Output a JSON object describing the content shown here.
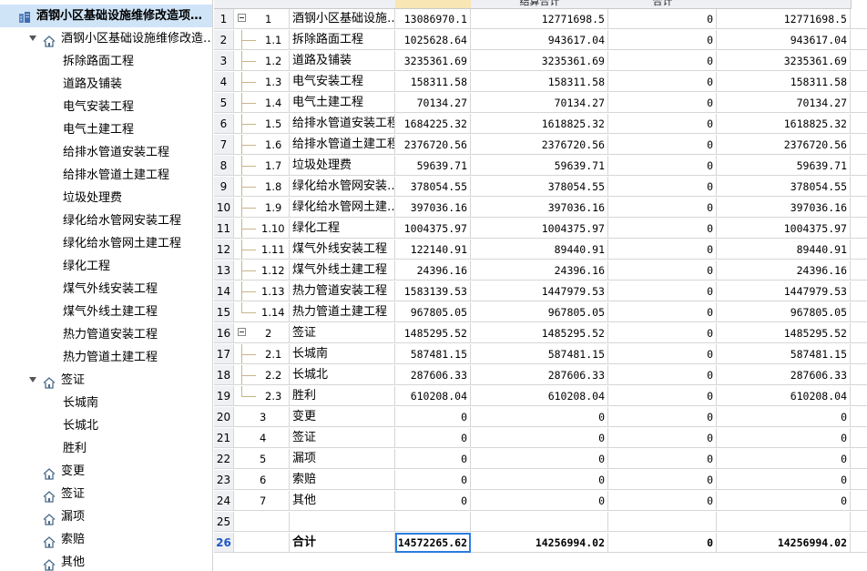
{
  "tree": {
    "root_label": "酒钢小区基础设施维修改造项…",
    "project_label": "酒钢小区基础设施维修改造…",
    "project_children": [
      "拆除路面工程",
      "道路及铺装",
      "电气安装工程",
      "电气土建工程",
      "给排水管道安装工程",
      "给排水管道土建工程",
      "垃圾处理费",
      "绿化给水管网安装工程",
      "绿化给水管网土建工程",
      "绿化工程",
      "煤气外线安装工程",
      "煤气外线土建工程",
      "热力管道安装工程",
      "热力管道土建工程"
    ],
    "visa_label": "签证",
    "visa_children": [
      "长城南",
      "长城北",
      "胜利"
    ],
    "others": [
      "变更",
      "签证",
      "漏项",
      "索赔",
      "其他"
    ]
  },
  "grid": {
    "headers": [
      "",
      "结算合计",
      "合计",
      ""
    ],
    "rows": [
      {
        "rn": "1",
        "code": "1",
        "name": "酒钢小区基础设施…",
        "a": "13086970.1",
        "b": "12771698.5",
        "c": "0",
        "d": "12771698.5"
      },
      {
        "rn": "2",
        "code": "1.1",
        "name": "拆除路面工程",
        "a": "1025628.64",
        "b": "943617.04",
        "c": "0",
        "d": "943617.04"
      },
      {
        "rn": "3",
        "code": "1.2",
        "name": "道路及铺装",
        "a": "3235361.69",
        "b": "3235361.69",
        "c": "0",
        "d": "3235361.69"
      },
      {
        "rn": "4",
        "code": "1.3",
        "name": "电气安装工程",
        "a": "158311.58",
        "b": "158311.58",
        "c": "0",
        "d": "158311.58"
      },
      {
        "rn": "5",
        "code": "1.4",
        "name": "电气土建工程",
        "a": "70134.27",
        "b": "70134.27",
        "c": "0",
        "d": "70134.27"
      },
      {
        "rn": "6",
        "code": "1.5",
        "name": "给排水管道安装工程",
        "a": "1684225.32",
        "b": "1618825.32",
        "c": "0",
        "d": "1618825.32"
      },
      {
        "rn": "7",
        "code": "1.6",
        "name": "给排水管道土建工程",
        "a": "2376720.56",
        "b": "2376720.56",
        "c": "0",
        "d": "2376720.56"
      },
      {
        "rn": "8",
        "code": "1.7",
        "name": "垃圾处理费",
        "a": "59639.71",
        "b": "59639.71",
        "c": "0",
        "d": "59639.71"
      },
      {
        "rn": "9",
        "code": "1.8",
        "name": "绿化给水管网安装…",
        "a": "378054.55",
        "b": "378054.55",
        "c": "0",
        "d": "378054.55"
      },
      {
        "rn": "10",
        "code": "1.9",
        "name": "绿化给水管网土建…",
        "a": "397036.16",
        "b": "397036.16",
        "c": "0",
        "d": "397036.16"
      },
      {
        "rn": "11",
        "code": "1.10",
        "name": "绿化工程",
        "a": "1004375.97",
        "b": "1004375.97",
        "c": "0",
        "d": "1004375.97"
      },
      {
        "rn": "12",
        "code": "1.11",
        "name": "煤气外线安装工程",
        "a": "122140.91",
        "b": "89440.91",
        "c": "0",
        "d": "89440.91"
      },
      {
        "rn": "13",
        "code": "1.12",
        "name": "煤气外线土建工程",
        "a": "24396.16",
        "b": "24396.16",
        "c": "0",
        "d": "24396.16"
      },
      {
        "rn": "14",
        "code": "1.13",
        "name": "热力管道安装工程",
        "a": "1583139.53",
        "b": "1447979.53",
        "c": "0",
        "d": "1447979.53"
      },
      {
        "rn": "15",
        "code": "1.14",
        "name": "热力管道土建工程",
        "a": "967805.05",
        "b": "967805.05",
        "c": "0",
        "d": "967805.05"
      },
      {
        "rn": "16",
        "code": "2",
        "name": "签证",
        "a": "1485295.52",
        "b": "1485295.52",
        "c": "0",
        "d": "1485295.52"
      },
      {
        "rn": "17",
        "code": "2.1",
        "name": "长城南",
        "a": "587481.15",
        "b": "587481.15",
        "c": "0",
        "d": "587481.15"
      },
      {
        "rn": "18",
        "code": "2.2",
        "name": "长城北",
        "a": "287606.33",
        "b": "287606.33",
        "c": "0",
        "d": "287606.33"
      },
      {
        "rn": "19",
        "code": "2.3",
        "name": "胜利",
        "a": "610208.04",
        "b": "610208.04",
        "c": "0",
        "d": "610208.04"
      },
      {
        "rn": "20",
        "code": "3",
        "name": "变更",
        "a": "0",
        "b": "0",
        "c": "0",
        "d": "0"
      },
      {
        "rn": "21",
        "code": "4",
        "name": "签证",
        "a": "0",
        "b": "0",
        "c": "0",
        "d": "0"
      },
      {
        "rn": "22",
        "code": "5",
        "name": "漏项",
        "a": "0",
        "b": "0",
        "c": "0",
        "d": "0"
      },
      {
        "rn": "23",
        "code": "6",
        "name": "索赔",
        "a": "0",
        "b": "0",
        "c": "0",
        "d": "0"
      },
      {
        "rn": "24",
        "code": "7",
        "name": "其他",
        "a": "0",
        "b": "0",
        "c": "0",
        "d": "0"
      },
      {
        "rn": "25",
        "code": "",
        "name": "",
        "a": "",
        "b": "",
        "c": "",
        "d": ""
      }
    ],
    "total": {
      "rn": "26",
      "name": "合计",
      "a": "14572265.62",
      "b": "14256994.02",
      "c": "0",
      "d": "14256994.02"
    }
  },
  "icons": {
    "home": "home-icon",
    "building": "building-icon",
    "collapse": "minus-box-icon",
    "expand_arrow": "caret-down-icon"
  },
  "colors": {
    "selection": "#cfe4f7",
    "accent": "#2a7de1",
    "header": "#eef0f3",
    "active_header": "#f9e6b5",
    "tree_line": "#c8b48a"
  }
}
